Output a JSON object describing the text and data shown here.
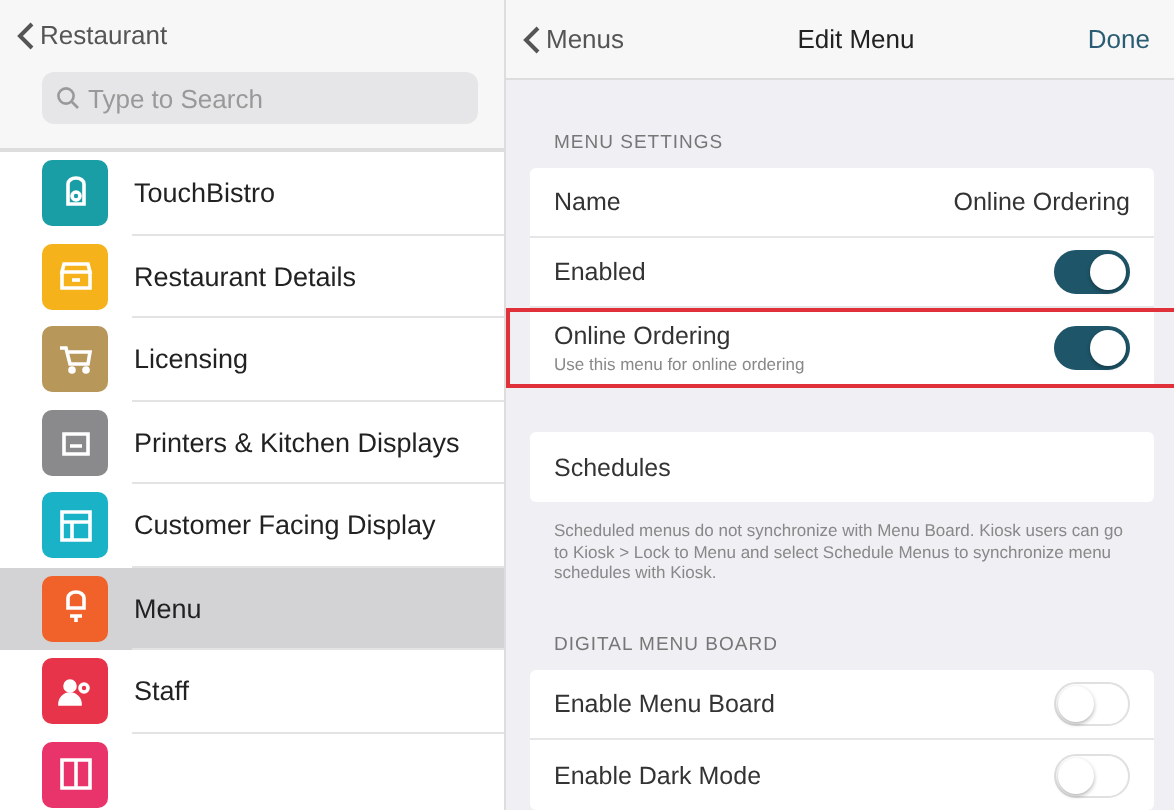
{
  "sidebar": {
    "back_label": "Restaurant",
    "search": {
      "placeholder": "Type to Search"
    },
    "items": [
      {
        "label": "TouchBistro",
        "color": "#1a9ea6",
        "selected": false
      },
      {
        "label": "Restaurant Details",
        "color": "#f5b21b",
        "selected": false
      },
      {
        "label": "Licensing",
        "color": "#b8975a",
        "selected": false
      },
      {
        "label": "Printers & Kitchen Displays",
        "color": "#8a8a8c",
        "selected": false
      },
      {
        "label": "Customer Facing Display",
        "color": "#1ab2c6",
        "selected": false
      },
      {
        "label": "Menu",
        "color": "#f0622a",
        "selected": true
      },
      {
        "label": "Staff",
        "color": "#e8344a",
        "selected": false
      },
      {
        "color": "#e8336b",
        "selected": false
      }
    ]
  },
  "detail": {
    "back_label": "Menus",
    "title": "Edit Menu",
    "done_label": "Done",
    "sections": [
      {
        "header": "MENU SETTINGS",
        "rows": [
          {
            "kind": "value",
            "label": "Name",
            "value": "Online Ordering",
            "highlighted": false
          },
          {
            "kind": "toggle",
            "label": "Enabled",
            "on": true,
            "highlighted": false
          },
          {
            "kind": "toggle",
            "label": "Online Ordering",
            "subtitle": "Use this menu for online ordering",
            "on": true,
            "highlighted": true
          }
        ]
      },
      {
        "rows": [
          {
            "kind": "link",
            "label": "Schedules",
            "highlighted": false
          }
        ],
        "footer": "Scheduled menus do not synchronize with Menu Board. Kiosk users can go to Kiosk > Lock to Menu and select Schedule Menus to synchronize menu schedules with Kiosk."
      },
      {
        "header": "DIGITAL MENU BOARD",
        "rows": [
          {
            "kind": "toggle",
            "label": "Enable Menu Board",
            "on": false,
            "highlighted": false
          },
          {
            "kind": "toggle",
            "label": "Enable Dark Mode",
            "on": false,
            "highlighted": false
          }
        ]
      }
    ]
  }
}
